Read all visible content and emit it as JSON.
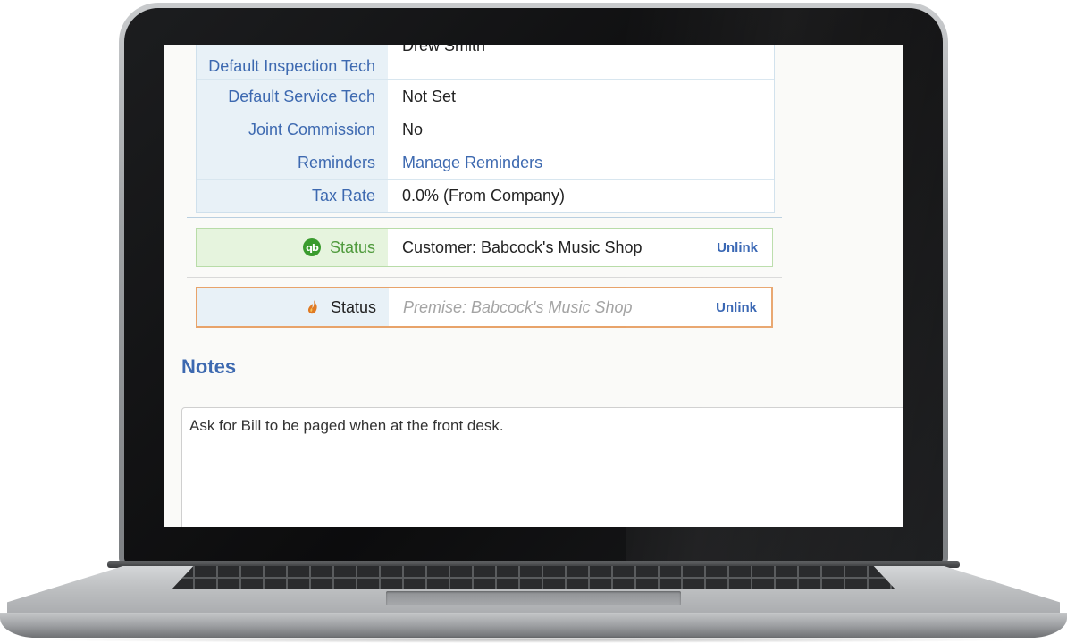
{
  "details": {
    "rows": [
      {
        "label": "Default Inspection Tech",
        "value": "Drew Smith"
      },
      {
        "label": "Default Service Tech",
        "value": "Not Set"
      },
      {
        "label": "Joint Commission",
        "value": "No"
      },
      {
        "label": "Reminders",
        "value": "Manage Reminders"
      },
      {
        "label": "Tax Rate",
        "value": "0.0% (From Company)"
      }
    ]
  },
  "integrations": {
    "quickbooks": {
      "label": "Status",
      "value": "Customer: Babcock's Music Shop",
      "action": "Unlink",
      "icon": "quickbooks-icon",
      "color": "#4f9a3c"
    },
    "premise": {
      "label": "Status",
      "value": "Premise: Babcock's Music Shop",
      "action": "Unlink",
      "icon": "flame-icon",
      "color": "#e8a36a"
    }
  },
  "notes": {
    "title": "Notes",
    "text": "Ask for Bill to be paged when at the front desk."
  },
  "colors": {
    "accent": "#3d69b0",
    "label_bg": "#e8f1f7"
  }
}
